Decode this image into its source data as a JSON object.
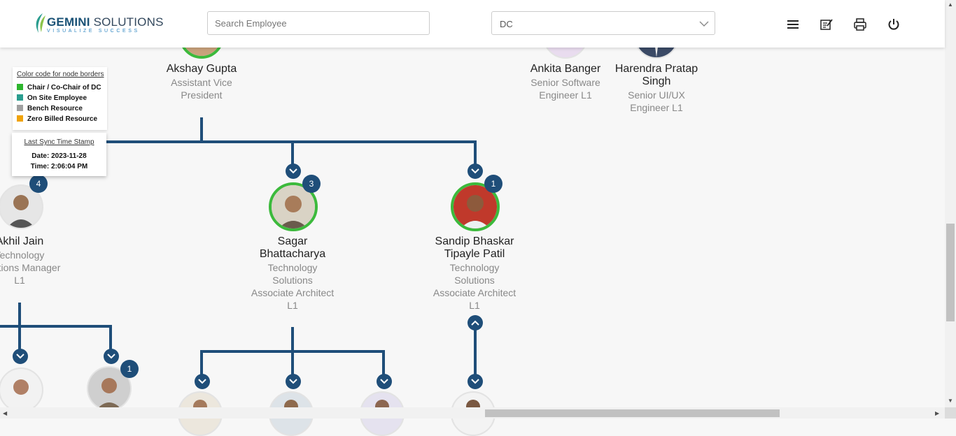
{
  "header": {
    "logo_title_bold": "GEMINI",
    "logo_title_rest": " SOLUTIONS",
    "logo_tagline": "VISUALIZE SUCCESS",
    "search_placeholder": "Search Employee",
    "department_value": "DC",
    "icons": [
      "menu-icon",
      "edit-note-icon",
      "print-icon",
      "power-icon"
    ]
  },
  "legend": {
    "heading": "Color code for node borders",
    "items": [
      {
        "label": "Chair / Co-Chair of DC",
        "color": "#2db52d"
      },
      {
        "label": "On Site Employee",
        "color": "#2a9d8f"
      },
      {
        "label": "Bench Resource",
        "color": "#a0a0a0"
      },
      {
        "label": "Zero Billed Resource",
        "color": "#f0a30a"
      }
    ]
  },
  "sync": {
    "heading": "Last Sync Time Stamp",
    "date": "Date: 2023-11-28",
    "time": "Time: 2:06:04 PM"
  },
  "nodes": {
    "akshay": {
      "name": "Akshay Gupta",
      "title_lines": [
        "Assistant Vice",
        "President"
      ]
    },
    "ankita": {
      "name": "Ankita Banger",
      "title_lines": [
        "Senior Software",
        "Engineer L1"
      ]
    },
    "harendra": {
      "name_lines": [
        "Harendra Pratap",
        "Singh"
      ],
      "title_lines": [
        "Senior UI/UX",
        "Engineer L1"
      ]
    },
    "akhil": {
      "name": "Akhil Jain",
      "badge": "4",
      "title_lines": [
        "Technology",
        "Solutions Manager",
        "L1"
      ]
    },
    "sagar": {
      "name_lines": [
        "Sagar",
        "Bhattacharya"
      ],
      "badge": "3",
      "title_lines": [
        "Technology",
        "Solutions",
        "Associate Architect",
        "L1"
      ]
    },
    "sandip": {
      "name_lines": [
        "Sandip Bhaskar",
        "Tipayle Patil"
      ],
      "badge": "1",
      "title_lines": [
        "Technology",
        "Solutions",
        "Associate Architect",
        "L1"
      ]
    },
    "akhil_child2": {
      "badge": "1"
    }
  },
  "colors": {
    "brand": "#1f4e79",
    "chair_border": "#3cba3c"
  }
}
